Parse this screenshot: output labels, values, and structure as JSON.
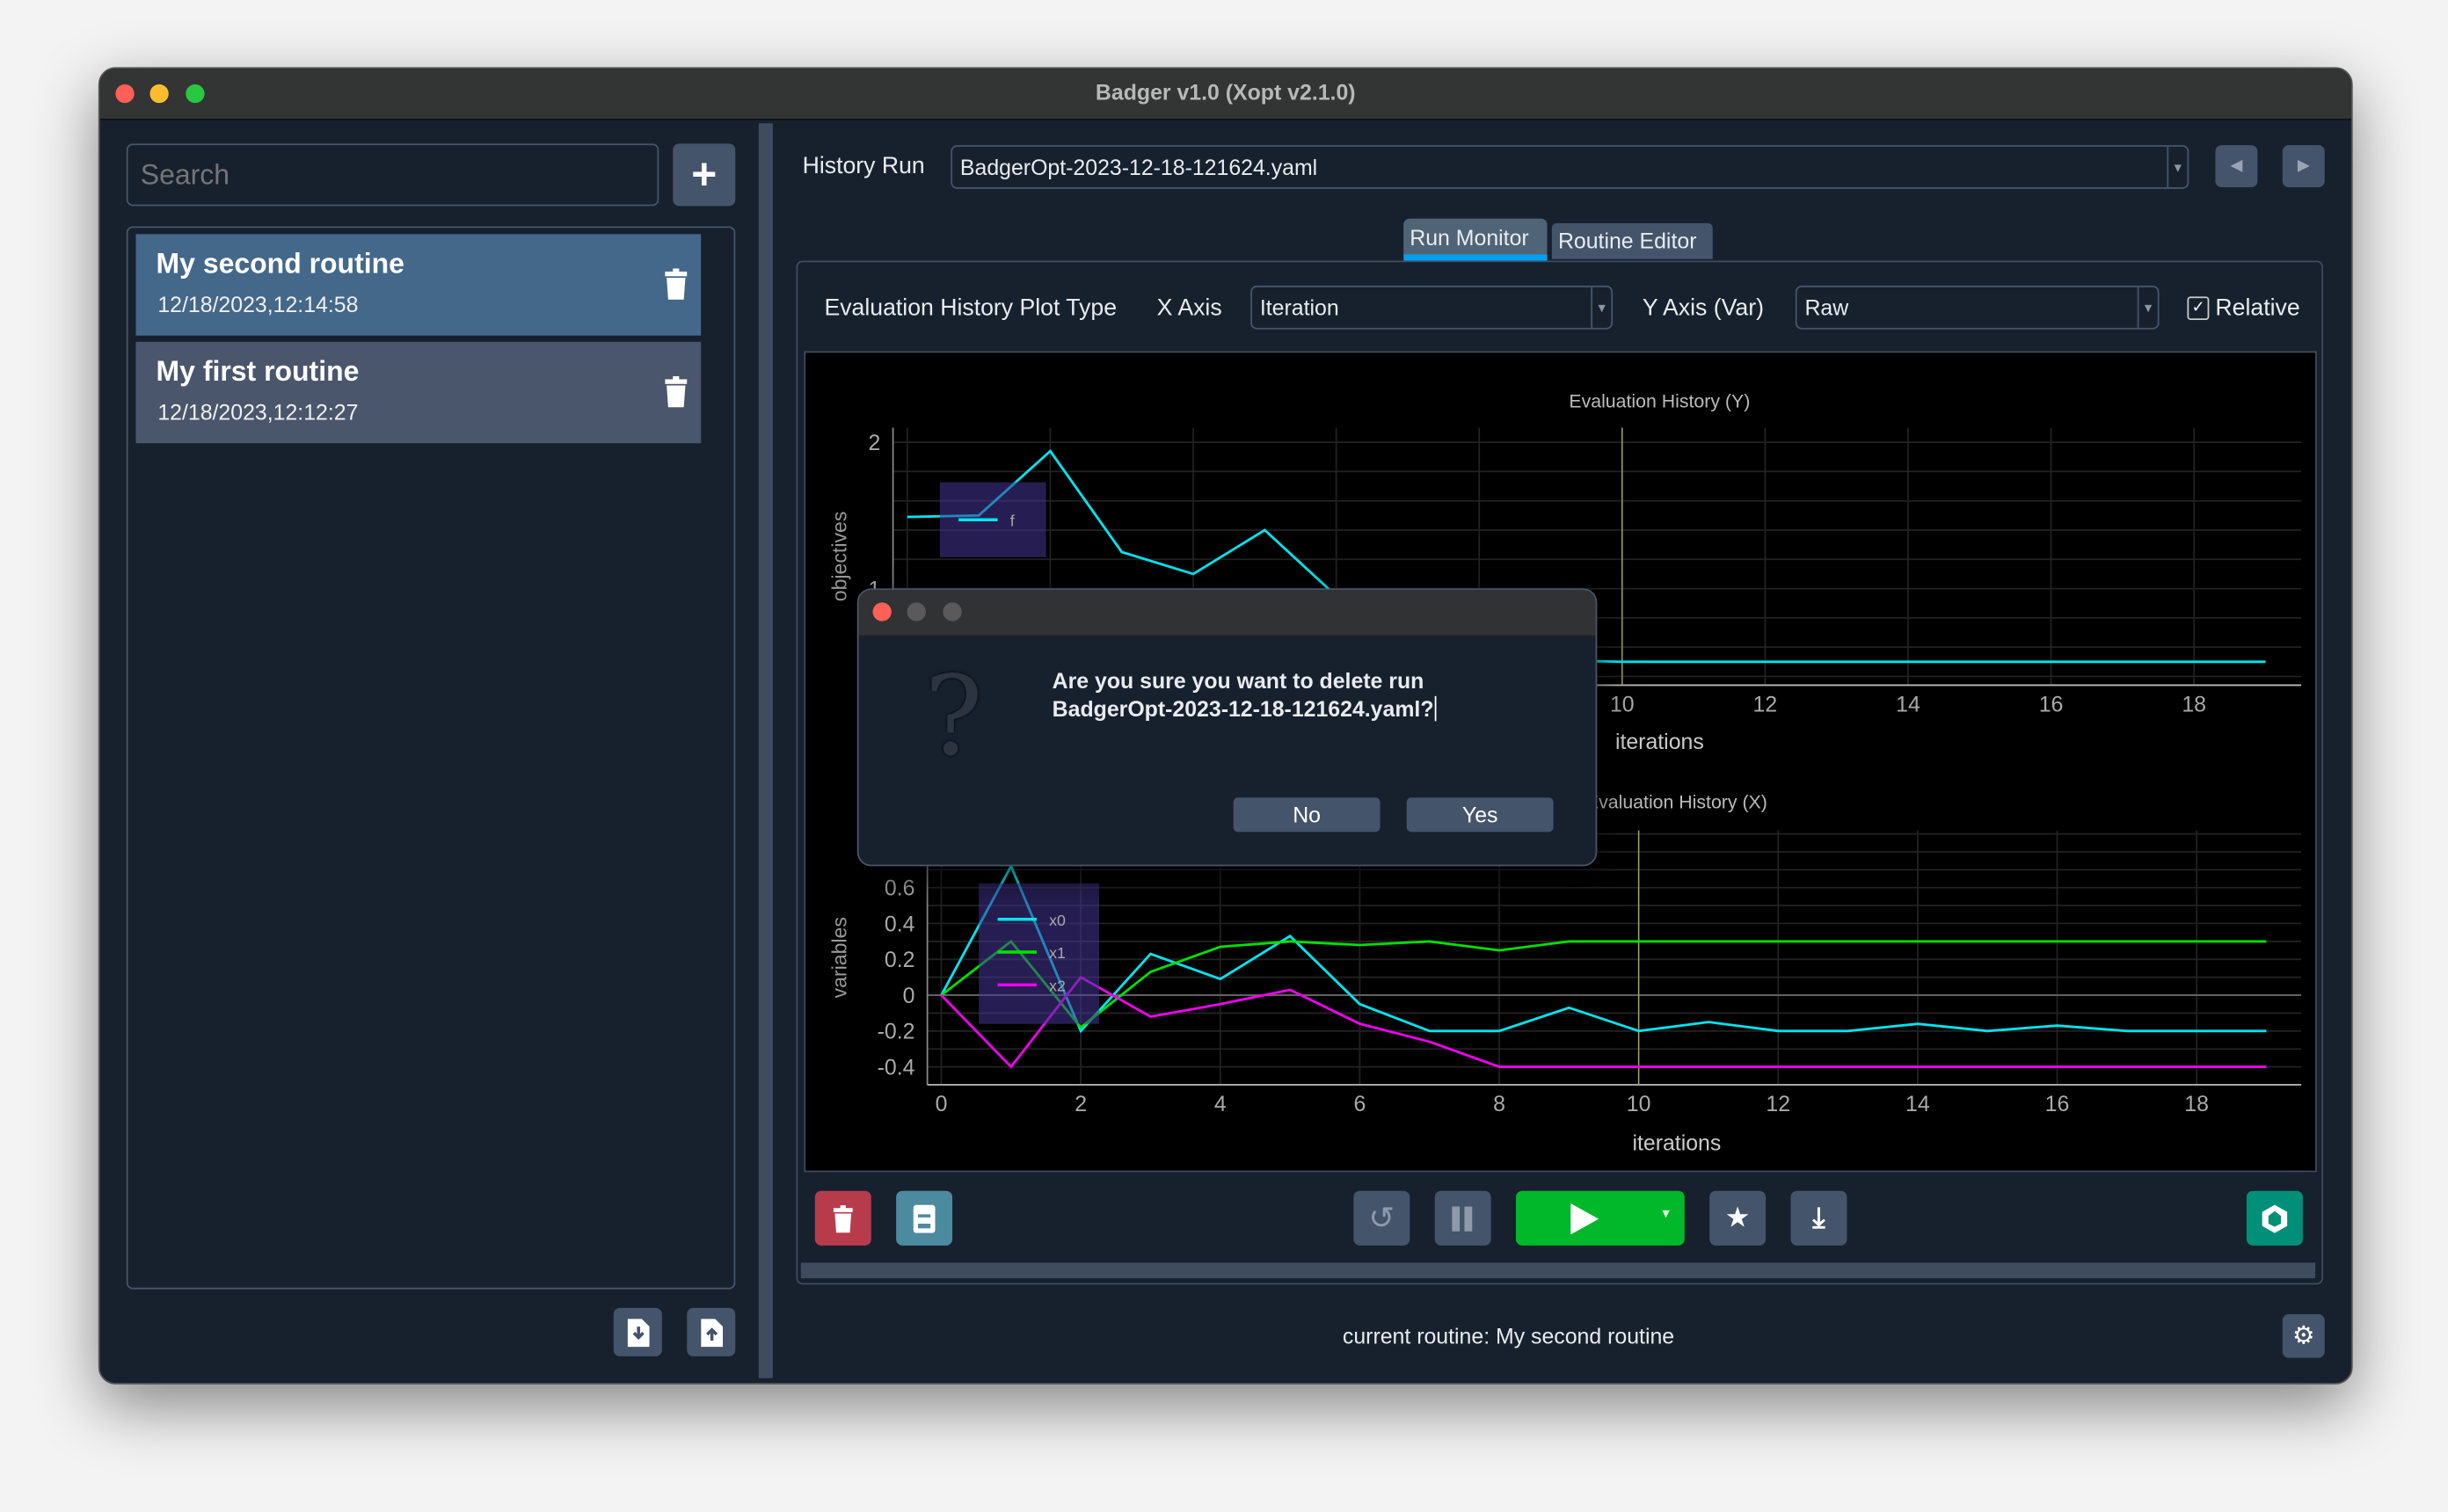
{
  "window": {
    "title": "Badger v1.0 (Xopt v2.1.0)"
  },
  "sidebar": {
    "search_placeholder": "Search",
    "routines": [
      {
        "name": "My second routine",
        "date": "12/18/2023,12:14:58",
        "selected": true
      },
      {
        "name": "My first routine",
        "date": "12/18/2023,12:12:27",
        "selected": false
      }
    ]
  },
  "header": {
    "history_run_label": "History Run",
    "history_run_value": "BadgerOpt-2023-12-18-121624.yaml"
  },
  "tabs": [
    {
      "label": "Run Monitor",
      "active": true
    },
    {
      "label": "Routine Editor",
      "active": false
    }
  ],
  "controls": {
    "plot_type_label": "Evaluation History Plot Type",
    "x_axis_label": "X Axis",
    "x_axis_value": "Iteration",
    "y_axis_label": "Y Axis (Var)",
    "y_axis_value": "Raw",
    "relative_label": "Relative",
    "relative_checked": true
  },
  "status": {
    "text": "current routine: My second routine"
  },
  "dialog": {
    "line1": "Are you sure you want to delete run",
    "line2": "BadgerOpt-2023-12-18-121624.yaml?",
    "no_label": "No",
    "yes_label": "Yes"
  },
  "colors": {
    "accent": "#00a0f0",
    "run": "#00b82a",
    "delete": "#b83b4c",
    "export": "#00907a",
    "selected": "#44688a"
  },
  "chart_data": [
    {
      "type": "line",
      "title": "Evaluation History (Y)",
      "xlabel": "iterations",
      "ylabel": "objectives",
      "xlim": [
        -0.2,
        19.5
      ],
      "ylim": [
        0.34,
        2.1
      ],
      "grid": true,
      "legend": "top-left",
      "marker_x": 10,
      "xticks": [
        0,
        2,
        4,
        6,
        8,
        10,
        12,
        14,
        16,
        18
      ],
      "yticks": [
        1,
        2
      ],
      "x": [
        0,
        1,
        2,
        3,
        4,
        5,
        6,
        7,
        8,
        9,
        10,
        11,
        12,
        13,
        14,
        15,
        16,
        17,
        18,
        19
      ],
      "series": [
        {
          "name": "f",
          "color": "#00e5f0",
          "values": [
            1.49,
            1.5,
            1.94,
            1.25,
            1.1,
            1.4,
            0.95,
            0.56,
            0.52,
            0.51,
            0.5,
            0.5,
            0.5,
            0.5,
            0.5,
            0.5,
            0.5,
            0.5,
            0.5,
            0.5
          ]
        }
      ]
    },
    {
      "type": "line",
      "title": "Evaluation History (X)",
      "xlabel": "iterations",
      "ylabel": "variables",
      "xlim": [
        -0.2,
        19.5
      ],
      "ylim": [
        -0.5,
        0.92
      ],
      "grid": true,
      "legend": "top-left",
      "marker_x": 10,
      "xticks": [
        0,
        2,
        4,
        6,
        8,
        10,
        12,
        14,
        16,
        18
      ],
      "yticks": [
        -0.4,
        -0.2,
        0,
        0.2,
        0.4,
        0.6
      ],
      "x": [
        0,
        1,
        2,
        3,
        4,
        5,
        6,
        7,
        8,
        9,
        10,
        11,
        12,
        13,
        14,
        15,
        16,
        17,
        18,
        19
      ],
      "series": [
        {
          "name": "x0",
          "color": "#00e5f0",
          "values": [
            0,
            0.72,
            -0.2,
            0.23,
            0.09,
            0.33,
            -0.05,
            -0.2,
            -0.2,
            -0.07,
            -0.2,
            -0.15,
            -0.2,
            -0.2,
            -0.16,
            -0.2,
            -0.17,
            -0.2,
            -0.2,
            -0.2
          ]
        },
        {
          "name": "x1",
          "color": "#00e000",
          "values": [
            0,
            0.3,
            -0.18,
            0.13,
            0.27,
            0.3,
            0.28,
            0.3,
            0.25,
            0.3,
            0.3,
            0.3,
            0.3,
            0.3,
            0.3,
            0.3,
            0.3,
            0.3,
            0.3,
            0.3
          ]
        },
        {
          "name": "x2",
          "color": "#f000f0",
          "values": [
            0,
            -0.4,
            0.1,
            -0.12,
            -0.05,
            0.03,
            -0.16,
            -0.26,
            -0.4,
            -0.4,
            -0.4,
            -0.4,
            -0.4,
            -0.4,
            -0.4,
            -0.4,
            -0.4,
            -0.4,
            -0.4,
            -0.4
          ]
        }
      ]
    }
  ]
}
